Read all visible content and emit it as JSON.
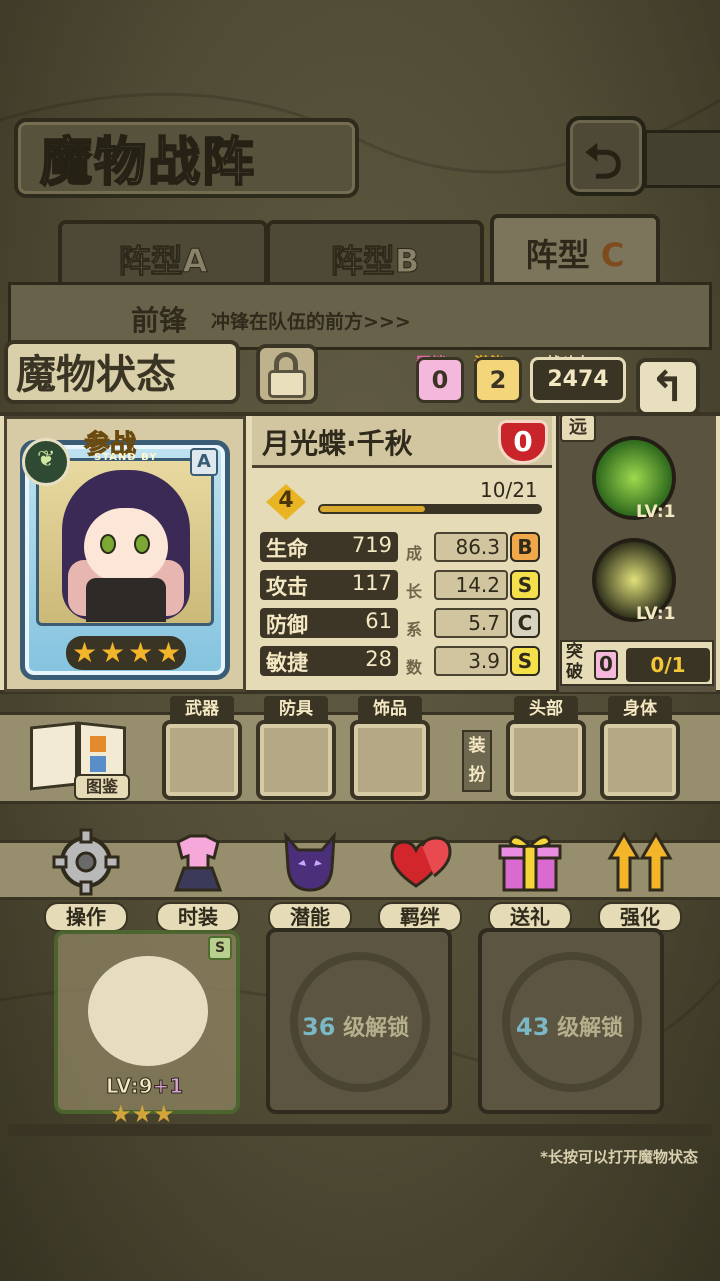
{
  "header": {
    "title": "魔物战阵",
    "back_icon": "return-arrow-icon"
  },
  "tabs": [
    {
      "prefix": "阵型",
      "letter": "A",
      "active": false
    },
    {
      "prefix": "阵型",
      "letter": "B",
      "active": false
    },
    {
      "prefix": "阵型",
      "letter": "C",
      "active": true
    }
  ],
  "formation": {
    "label": "前锋",
    "description": "冲锋在队伍的前方>>>"
  },
  "status": {
    "title": "魔物状态",
    "bond": {
      "label": "羁绊",
      "value": "0"
    },
    "potential": {
      "label": "潜能",
      "value": "2"
    },
    "power": {
      "label": "战斗力",
      "value": "2474"
    }
  },
  "monster": {
    "stand_by": "参战",
    "stand_by_sub": "STAND BY",
    "rank": "A",
    "stars": 4,
    "name": "月光蝶·千秋",
    "heart_value": "0",
    "level": "4",
    "exp_text": "10/21",
    "exp_progress": 0.476,
    "growth_label": [
      "成",
      "长",
      "系",
      "数"
    ],
    "stats": [
      {
        "label": "生命",
        "value": "719",
        "growth": "86.3",
        "grade": "B"
      },
      {
        "label": "攻击",
        "value": "117",
        "growth": "14.2",
        "grade": "S"
      },
      {
        "label": "防御",
        "value": "61",
        "growth": "5.7",
        "grade": "C"
      },
      {
        "label": "敏捷",
        "value": "28",
        "growth": "3.9",
        "grade": "S"
      }
    ]
  },
  "skills": {
    "range_tag": "远",
    "items": [
      {
        "lv": "LV:1"
      },
      {
        "lv": "LV:1"
      }
    ],
    "breakthrough": {
      "label": "突破",
      "count": "0",
      "progress": "0/1"
    }
  },
  "equipment": {
    "encyclopedia_label": "图鉴",
    "slots": [
      {
        "label": "武器"
      },
      {
        "label": "防具"
      },
      {
        "label": "饰品"
      },
      {
        "label": "头部"
      },
      {
        "label": "身体"
      }
    ],
    "dress_tag": "装扮"
  },
  "actions": [
    {
      "label": "操作"
    },
    {
      "label": "时装"
    },
    {
      "label": "潜能"
    },
    {
      "label": "羁绊"
    },
    {
      "label": "送礼"
    },
    {
      "label": "强化"
    }
  ],
  "team": {
    "member": {
      "level": "LV:9",
      "plus": "+1",
      "stars": 3,
      "grade": "S"
    },
    "locked": [
      {
        "level": "36",
        "text": "级解锁"
      },
      {
        "level": "43",
        "text": "级解锁"
      }
    ]
  },
  "hint": "*长按可以打开魔物状态"
}
